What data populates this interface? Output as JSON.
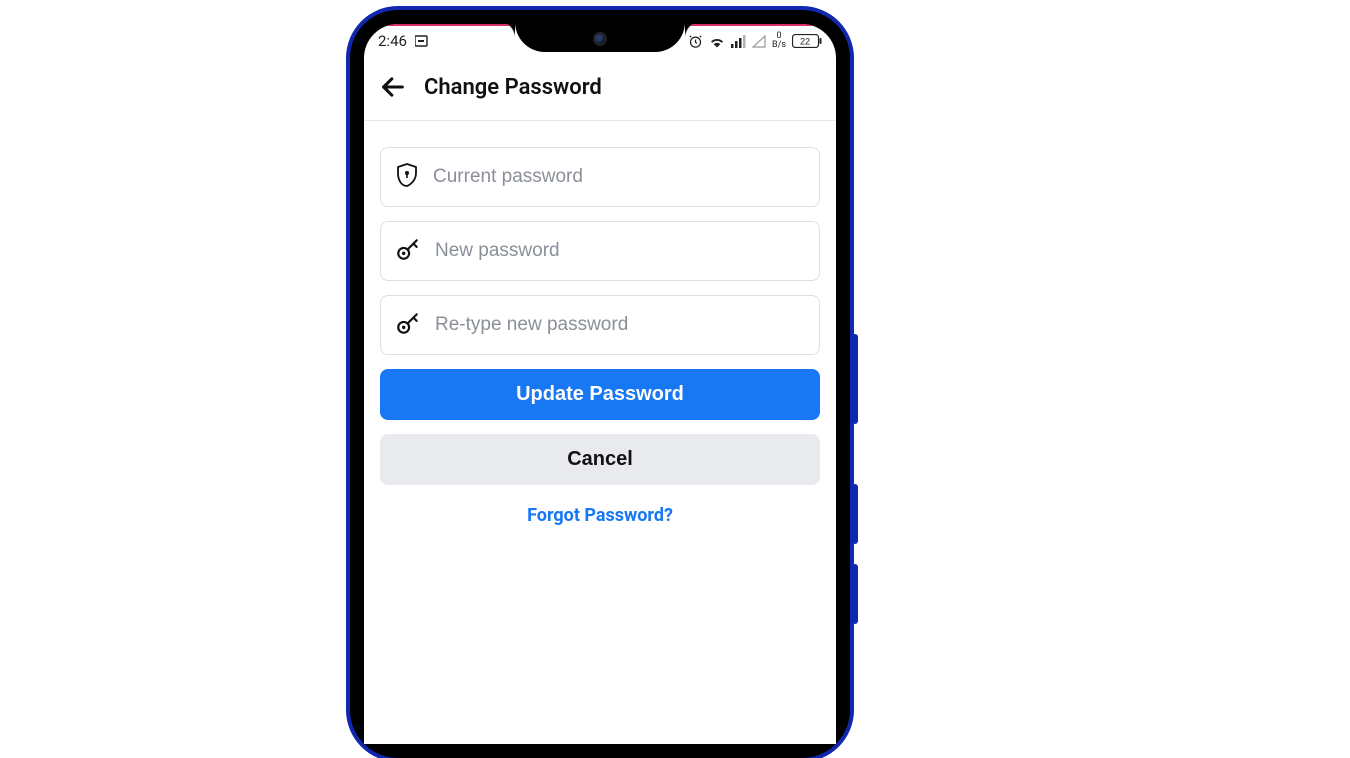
{
  "status": {
    "time": "2:46",
    "battery": "22",
    "data_rate_top": "0",
    "data_rate_bottom": "B/s"
  },
  "header": {
    "title": "Change Password"
  },
  "form": {
    "current_placeholder": "Current password",
    "new_placeholder": "New password",
    "retype_placeholder": "Re-type new password",
    "submit_label": "Update Password",
    "cancel_label": "Cancel",
    "forgot_label": "Forgot Password?"
  }
}
